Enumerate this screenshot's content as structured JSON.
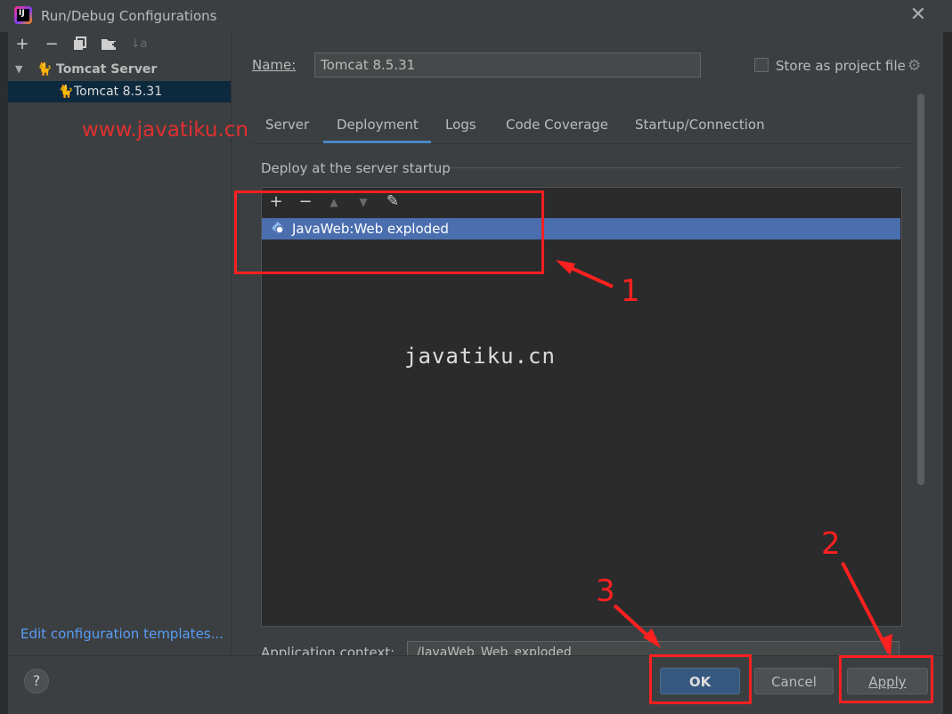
{
  "window": {
    "title": "Run/Debug Configurations",
    "logo_text": "IJ"
  },
  "sidebar": {
    "toolbar": [
      "add-icon",
      "remove-icon",
      "copy-icon",
      "folder-add-icon",
      "sort-icon"
    ],
    "tree": [
      {
        "label": "Tomcat Server",
        "expanded": true
      },
      {
        "label": "Tomcat 8.5.31",
        "selected": true
      }
    ],
    "edit_templates_link": "Edit configuration templates..."
  },
  "name_field": {
    "label": "Name:",
    "value": "Tomcat 8.5.31"
  },
  "store_as_project_file": {
    "label": "Store as project file",
    "checked": false
  },
  "tabs": [
    {
      "label": "Server"
    },
    {
      "label": "Deployment",
      "active": true
    },
    {
      "label": "Logs"
    },
    {
      "label": "Code Coverage"
    },
    {
      "label": "Startup/Connection"
    }
  ],
  "deployment": {
    "section_title": "Deploy at the server startup",
    "items": [
      {
        "label": "JavaWeb:Web exploded",
        "selected": true
      }
    ]
  },
  "application_context": {
    "label": "Application context:",
    "value": "/JavaWeb_Web_exploded"
  },
  "buttons": {
    "ok": "OK",
    "cancel": "Cancel",
    "apply": "Apply",
    "help": "?"
  },
  "watermarks": {
    "red": "www.javatiku.cn",
    "center": "javatiku.cn"
  },
  "annotations": {
    "n1": "1",
    "n2": "2",
    "n3": "3"
  },
  "colors": {
    "accent": "#4b6eaf",
    "annotation": "#ff2020",
    "link": "#589df6"
  }
}
